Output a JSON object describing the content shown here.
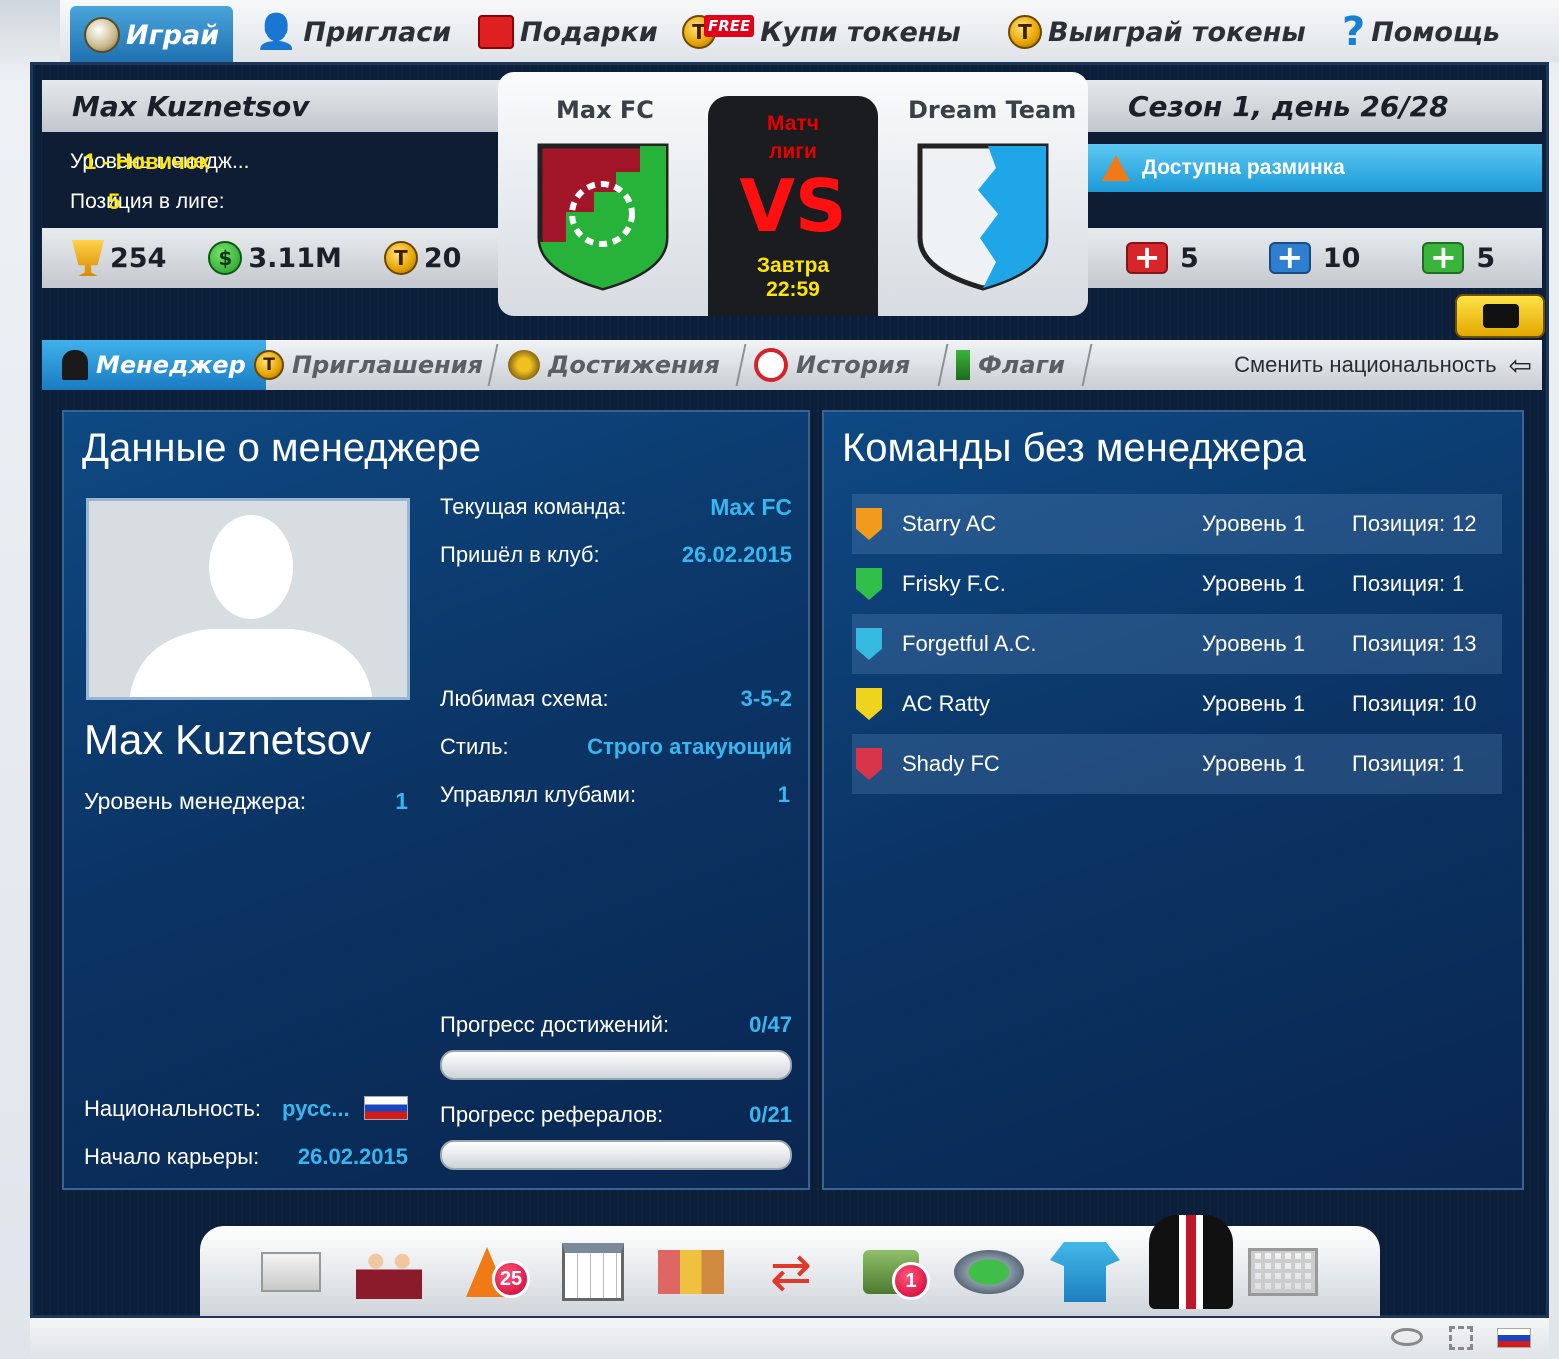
{
  "nav": {
    "play": "Играй",
    "invite": "Пригласи",
    "gifts": "Подарки",
    "free_tag": "FREE",
    "buy_tokens": "Купи токены",
    "win_tokens": "Выиграй токены",
    "help": "Помощь"
  },
  "manager_header": {
    "name": "Max Kuznetsov",
    "level_label": "Уровень менедж...",
    "level_value": "1 - Новичок",
    "league_pos_label": "Позиция в лиге:",
    "league_pos_value": "5",
    "trophies": "254",
    "money": "3.11M",
    "tokens": "20"
  },
  "match": {
    "home": "Max FC",
    "away": "Dream Team",
    "type": "Матч лиги",
    "vs": "VS",
    "day": "Завтра",
    "time": "22:59"
  },
  "season_header": {
    "season": "Сезон 1, день 26/28",
    "warmup": "Доступна разминка",
    "med_red": "5",
    "med_blue": "10",
    "med_green": "5"
  },
  "tabs": {
    "manager": "Менеджер",
    "invites": "Приглашения",
    "achievements": "Достижения",
    "history": "История",
    "flags": "Флаги",
    "change_nationality": "Сменить национальность"
  },
  "manager_panel": {
    "title": "Данные о менеджере",
    "name": "Max Kuznetsov",
    "level_label": "Уровень менеджера:",
    "level_value": "1",
    "nationality_label": "Национальность:",
    "nationality_value": "русс...",
    "career_start_label": "Начало карьеры:",
    "career_start_value": "26.02.2015",
    "current_team_label": "Текущая команда:",
    "current_team_value": "Max FC",
    "joined_label": "Пришёл в клуб:",
    "joined_value": "26.02.2015",
    "formation_label": "Любимая схема:",
    "formation_value": "3-5-2",
    "style_label": "Стиль:",
    "style_value": "Строго атакующий",
    "clubs_label": "Управлял клубами:",
    "clubs_value": "1",
    "achievements_label": "Прогресс достижений:",
    "achievements_value": "0/47",
    "achievements_progress": 0,
    "referrals_label": "Прогресс рефералов:",
    "referrals_value": "0/21",
    "referrals_progress": 0
  },
  "teams_panel": {
    "title": "Команды без менеджера",
    "teams": [
      {
        "name": "Starry AC",
        "level": "Уровень 1",
        "pos_label": "Позиция:",
        "pos": "12",
        "color": "#f29a1c"
      },
      {
        "name": "Frisky F.C.",
        "level": "Уровень 1",
        "pos_label": "Позиция:",
        "pos": "1",
        "color": "#2fbf4a"
      },
      {
        "name": "Forgetful A.C.",
        "level": "Уровень 1",
        "pos_label": "Позиция:",
        "pos": "13",
        "color": "#36b9e0"
      },
      {
        "name": "AC Ratty",
        "level": "Уровень 1",
        "pos_label": "Позиция:",
        "pos": "10",
        "color": "#f0d31c"
      },
      {
        "name": "Shady FC",
        "level": "Уровень 1",
        "pos_label": "Позиция:",
        "pos": "1",
        "color": "#d8344a"
      }
    ]
  },
  "dock": {
    "training_badge": "25",
    "finance_badge": "1"
  }
}
